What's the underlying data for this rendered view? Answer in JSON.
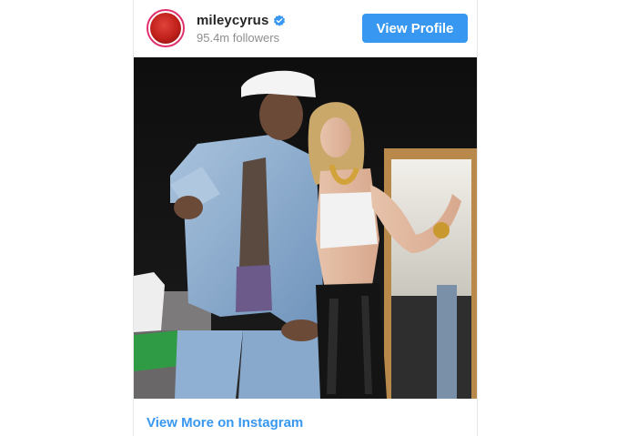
{
  "post": {
    "username": "mileycyrus",
    "followers": "95.4m followers",
    "verified": true,
    "view_profile_label": "View Profile",
    "more_link_label": "View More on Instagram",
    "accent_color": "#3897f0"
  },
  "icons": {
    "verified": "verified-badge-icon"
  }
}
